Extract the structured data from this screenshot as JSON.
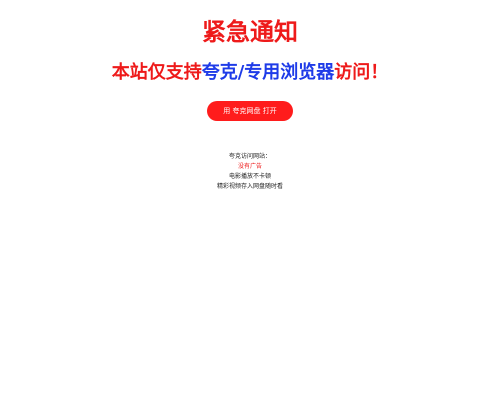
{
  "colors": {
    "red": "#ee1a1a",
    "blue": "#1e3be8",
    "button_bg": "#ff1c1c",
    "text_dark": "#222222"
  },
  "header": {
    "title": "紧急通知"
  },
  "notice": {
    "part1": "本站仅支持",
    "part2": "夸克/专用浏览器",
    "part3": "访问！"
  },
  "open_button": {
    "label": "用 夸克网盘 打开"
  },
  "info": {
    "line1": "夸克访问网站：",
    "line2": "没有广告",
    "line3": "电影播放不卡顿",
    "line4": "精彩视频存入网盘随时看"
  }
}
